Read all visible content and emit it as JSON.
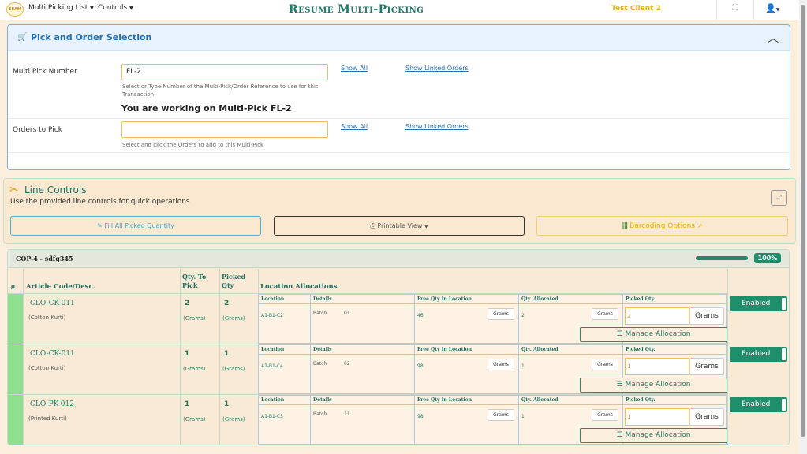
{
  "topbar": {
    "logo_text": "SEAM",
    "nav": [
      {
        "label": "Multi Picking List"
      },
      {
        "label": "Controls"
      }
    ],
    "title": "Resume Multi-Picking",
    "client": "Test Client 2"
  },
  "selection": {
    "title": "Pick and Order Selection",
    "multi_pick_label": "Multi Pick Number",
    "multi_pick_value": "FL-2",
    "multi_pick_help": "Select or Type Number of the Multi-Pick/Order Reference to use for this Transaction",
    "show_all": "Show All",
    "show_linked": "Show Linked Orders",
    "working_text": "You are working on Multi-Pick FL-2",
    "orders_label": "Orders to Pick",
    "orders_value": "",
    "orders_help": "Select and click the Orders to add to this Multi-Pick"
  },
  "line_controls": {
    "title": "Line Controls",
    "subtitle": "Use the provided line controls for quick operations",
    "fill_all": "Fill All Picked Quantity",
    "printable": "Printable View",
    "barcoding": "Barcoding Options"
  },
  "order": {
    "title": "COP-4 - sdfg345",
    "progress_pct": 100,
    "progress_label": "100%",
    "headers": {
      "hash": "#",
      "article": "Article Code/Desc.",
      "qty_to_pick": "Qty. To Pick",
      "picked_qty": "Picked Qty",
      "location_alloc": "Location Allocations"
    },
    "alloc_headers": {
      "location": "Location",
      "details": "Details",
      "free_qty": "Free Qty In Location",
      "qty_alloc": "Qty. Allocated",
      "picked": "Picked Qty."
    },
    "manage_label": "Manage Allocation",
    "enabled_label": "Enabled",
    "lines": [
      {
        "code": "CLO-CK-011",
        "desc": "(Cotton Kurti)",
        "qty_to_pick": "2",
        "picked": "2",
        "unit": "(Grams)",
        "location": "A1-B1-C2",
        "batch_label": "Batch",
        "batch": "01",
        "free_qty": "46",
        "free_unit": "Grams",
        "allocated": "2",
        "alloc_unit": "Grams",
        "picked_input": "2",
        "picked_unit": "Grams"
      },
      {
        "code": "CLO-CK-011",
        "desc": "(Cotton Kurti)",
        "qty_to_pick": "1",
        "picked": "1",
        "unit": "(Grams)",
        "location": "A1-B1-C4",
        "batch_label": "Batch",
        "batch": "02",
        "free_qty": "98",
        "free_unit": "Grams",
        "allocated": "1",
        "alloc_unit": "Grams",
        "picked_input": "1",
        "picked_unit": "Grams"
      },
      {
        "code": "CLO-PK-012",
        "desc": "(Printed Kurti)",
        "qty_to_pick": "1",
        "picked": "1",
        "unit": "(Grams)",
        "location": "A1-B1-C5",
        "batch_label": "Batch",
        "batch": "11",
        "free_qty": "98",
        "free_unit": "Grams",
        "allocated": "1",
        "alloc_unit": "Grams",
        "picked_input": "1",
        "picked_unit": "Grams"
      }
    ]
  }
}
